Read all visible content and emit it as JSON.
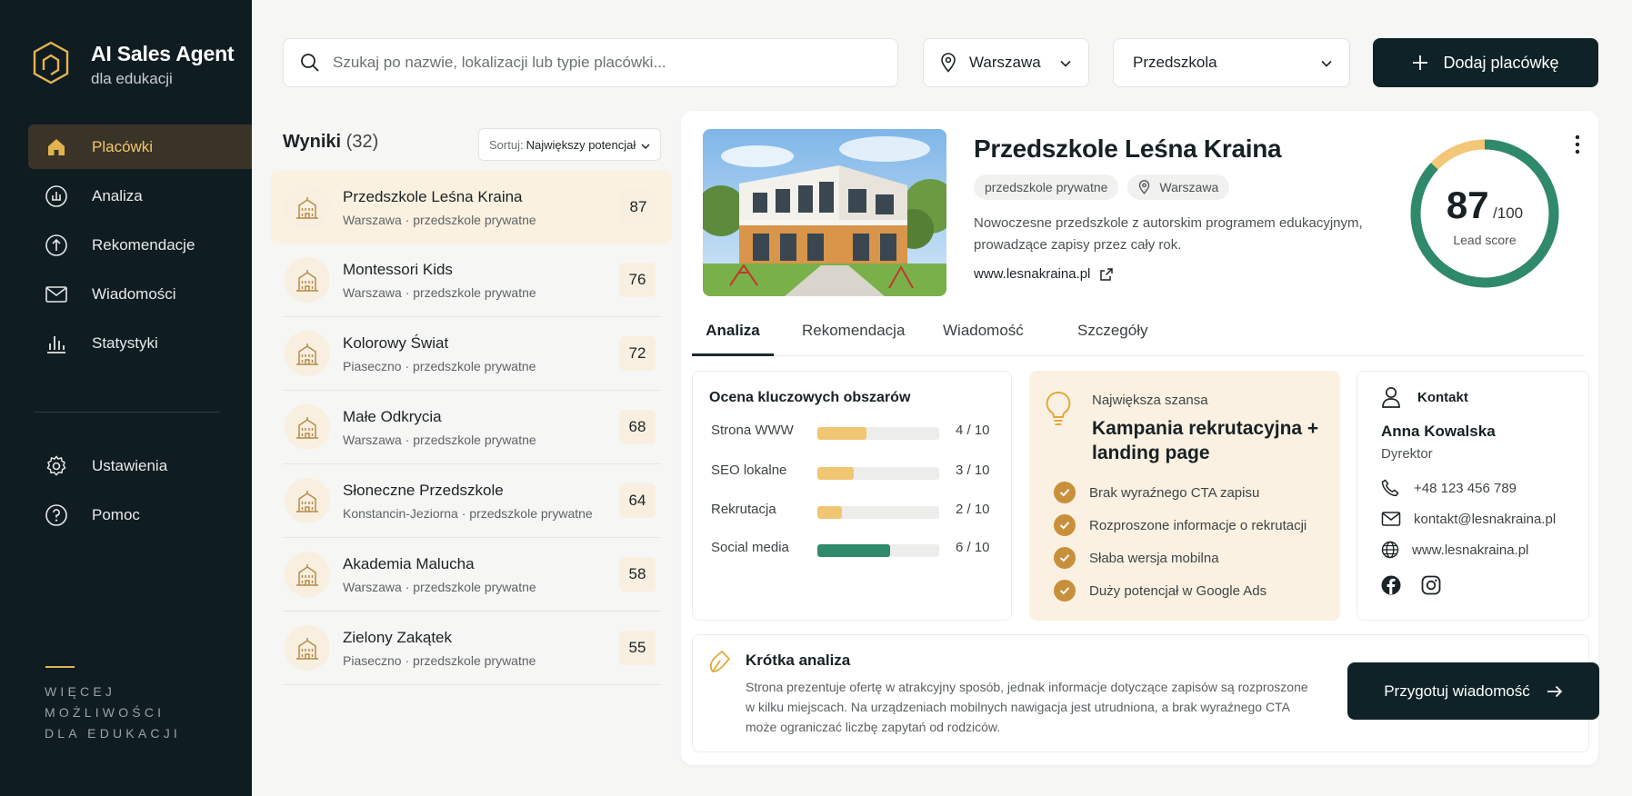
{
  "brand": {
    "title": "AI Sales Agent",
    "subtitle": "dla edukacji",
    "logo_icon": "hexagon-logo-icon"
  },
  "sidebar": {
    "items": [
      {
        "label": "Placówki",
        "icon": "home-icon",
        "active": true
      },
      {
        "label": "Analiza",
        "icon": "chart-circle-icon"
      },
      {
        "label": "Rekomendacje",
        "icon": "recommend-icon"
      },
      {
        "label": "Wiadomości",
        "icon": "mail-icon"
      },
      {
        "label": "Statystyki",
        "icon": "bar-chart-icon"
      }
    ],
    "bottom_items": [
      {
        "label": "Ustawienia",
        "icon": "gear-icon"
      },
      {
        "label": "Pomoc",
        "icon": "help-icon"
      }
    ],
    "more_text_lines": [
      "WIĘCEJ",
      "MOŻLIWOŚCI",
      "DLA EDUKACJI"
    ]
  },
  "topbar": {
    "search_placeholder": "Szukaj po nazwie, lokalizacji lub typie placówki...",
    "city": "Warszawa",
    "type": "Przedszkola",
    "add_button": "Dodaj placówkę"
  },
  "results": {
    "heading": "Wyniki",
    "count": "(32)",
    "sort_label": "Sortuj:",
    "sort_value": "Największy potencjał",
    "items": [
      {
        "name": "Przedszkole Leśna Kraina",
        "meta": "Warszawa · przedszkole prywatne",
        "score": "87",
        "active": true
      },
      {
        "name": "Montessori Kids",
        "meta": "Warszawa · przedszkole prywatne",
        "score": "76"
      },
      {
        "name": "Kolorowy Świat",
        "meta": "Piaseczno · przedszkole prywatne",
        "score": "72"
      },
      {
        "name": "Małe Odkrycia",
        "meta": "Warszawa · przedszkole prywatne",
        "score": "68"
      },
      {
        "name": "Słoneczne Przedszkole",
        "meta": "Konstancin-Jeziorna · przedszkole prywatne",
        "score": "64"
      },
      {
        "name": "Akademia Malucha",
        "meta": "Warszawa · przedszkole prywatne",
        "score": "58"
      },
      {
        "name": "Zielony Zakątek",
        "meta": "Piaseczno · przedszkole prywatne",
        "score": "55"
      }
    ]
  },
  "detail": {
    "title": "Przedszkole Leśna Kraina",
    "chip_type": "przedszkole prywatne",
    "chip_city": "Warszawa",
    "description": "Nowoczesne przedszkole z autorskim programem edukacyjnym, prowadzące zapisy przez cały rok.",
    "website": "www.lesnakraina.pl",
    "lead_score": "87",
    "lead_score_max": "/100",
    "lead_score_value": 87,
    "lead_label": "Lead score",
    "tabs": [
      "Analiza",
      "Rekomendacja",
      "Wiadomość",
      "Szczegóły"
    ],
    "areas": {
      "title": "Ocena kluczowych obszarów",
      "rows": [
        {
          "label": "Strona WWW",
          "value": "4 / 10",
          "score": 4,
          "color": "#f1c672"
        },
        {
          "label": "SEO lokalne",
          "value": "3 / 10",
          "score": 3,
          "color": "#f1c672"
        },
        {
          "label": "Rekrutacja",
          "value": "2 / 10",
          "score": 2,
          "color": "#f1c672"
        },
        {
          "label": "Social media",
          "value": "6 / 10",
          "score": 6,
          "color": "#2e8a6a"
        }
      ]
    },
    "opportunity": {
      "label": "Największa szansa",
      "title": "Kampania rekrutacyjna + landing page",
      "items": [
        "Brak wyraźnego CTA zapisu",
        "Rozproszone informacje o rekrutacji",
        "Słaba wersja mobilna",
        "Duży potencjał w Google Ads"
      ]
    },
    "contact": {
      "title": "Kontakt",
      "name": "Anna Kowalska",
      "role": "Dyrektor",
      "phone": "+48 123 456 789",
      "email": "kontakt@lesnakraina.pl",
      "web": "www.lesnakraina.pl"
    },
    "summary": {
      "title": "Krótka analiza",
      "text": "Strona prezentuje ofertę w atrakcyjny sposób, jednak informacje dotyczące zapisów są rozproszone w kilku miejscach. Na urządzeniach mobilnych nawigacja jest utrudniona, a brak wyraźnego CTA może ograniczać liczbę zapytań od rodziców.",
      "button": "Przygotuj wiadomość"
    }
  },
  "colors": {
    "accent_gold": "#e3b350",
    "dark": "#0f1c21",
    "green": "#2e8a6a",
    "peach": "#fbf1e2"
  }
}
